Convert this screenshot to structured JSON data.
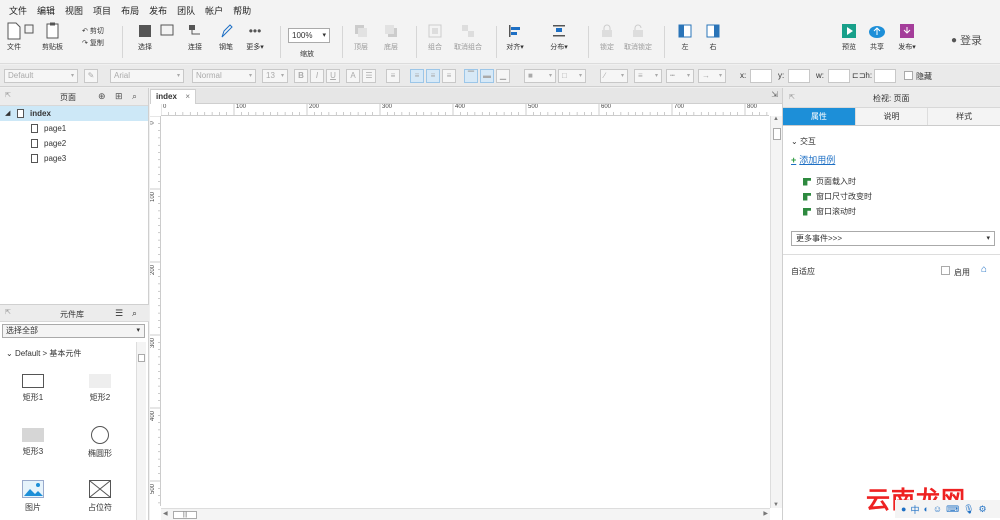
{
  "menubar": [
    "文件",
    "编辑",
    "视图",
    "项目",
    "布局",
    "发布",
    "团队",
    "帐户",
    "帮助"
  ],
  "toolbar": {
    "file": "文件",
    "clipboard": "剪贴板",
    "cut_label": "剪切",
    "copy_label": "复制",
    "select": "选择",
    "connect": "连接",
    "pen": "钢笔",
    "more": "更多",
    "zoom_value": "100%",
    "zoom_label": "缩放",
    "top": "顶层",
    "bottom": "底层",
    "group": "组合",
    "ungroup": "取消组合",
    "align": "对齐",
    "distribute": "分布",
    "lock": "锁定",
    "unlock": "取消锁定",
    "left": "左",
    "right": "右",
    "preview": "预览",
    "share": "共享",
    "publish": "发布",
    "login": "登录"
  },
  "formatbar": {
    "style": "Default",
    "font": "Arial",
    "weight": "Normal",
    "size": "13",
    "bold": "B",
    "italic": "I",
    "underline": "U",
    "x_label": "x:",
    "y_label": "y:",
    "w_label": "w:",
    "h_label": "h:",
    "hide_label": "隐藏"
  },
  "pages_panel": {
    "title": "页面",
    "items": [
      {
        "label": "index",
        "selected": true
      },
      {
        "label": "page1"
      },
      {
        "label": "page2"
      },
      {
        "label": "page3"
      }
    ]
  },
  "library_panel": {
    "title": "元件库",
    "select": "选择全部",
    "path": "Default > 基本元件",
    "widgets": [
      "矩形1",
      "矩形2",
      "矩形3",
      "椭圆形",
      "图片",
      "占位符"
    ]
  },
  "canvas": {
    "tab": "index",
    "hruler": [
      "0",
      "100",
      "200",
      "300",
      "400",
      "500",
      "600",
      "700",
      "800"
    ],
    "vruler": [
      "0",
      "100",
      "200",
      "300",
      "400",
      "500"
    ]
  },
  "inspector": {
    "title": "检视: 页面",
    "tabs": [
      "属性",
      "说明",
      "样式"
    ],
    "interaction": "交互",
    "add_case": "添加用例",
    "events": [
      "页面载入时",
      "窗口尺寸改变时",
      "窗口滚动时"
    ],
    "more_events": "更多事件>>>",
    "adaptive": "自适应",
    "enable": "启用"
  },
  "watermark": "云南龙网"
}
